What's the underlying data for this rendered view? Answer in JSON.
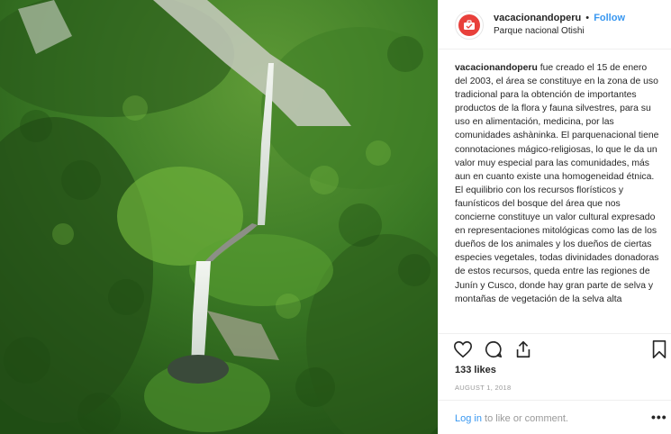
{
  "post": {
    "username": "vacacionandoperu",
    "separator": "•",
    "follow_label": "Follow",
    "location": "Parque nacional Otishi",
    "caption_user": "vacacionandoperu",
    "caption_text": "fue creado el 15 de enero del 2003, el área se constituye en la zona de uso tradicional para la obtención de importantes productos de la flora y fauna silvestres, para su uso en alimentación, medicina, por las comunidades ashàninka. El parquenacional tiene connotaciones mágico-religiosas, lo que le da un valor muy especial para las comunidades, más aun en cuanto existe una homogeneidad étnica. El equilibrio con los recursos florísticos y faunísticos del bosque del área que nos concierne constituye un valor cultural expresado en representaciones mitológicas como las de los dueños de los animales y los dueños de ciertas especies vegetales, todas divinidades donadoras de estos recursos, queda entre las regiones de Junín y Cusco, donde hay gran parte de selva y montañas de vegetación de la selva alta",
    "likes": "133 likes",
    "date": "AUGUST 1, 2018",
    "login_link": "Log in",
    "login_rest": " to like or comment.",
    "more_label": "•••"
  },
  "icons": {
    "avatar": "suitcase-icon",
    "like": "heart-icon",
    "comment": "comment-icon",
    "share": "share-icon",
    "save": "bookmark-icon"
  },
  "colors": {
    "link": "#3897f0",
    "avatar_bg": "#e8403b",
    "muted": "#999999"
  }
}
